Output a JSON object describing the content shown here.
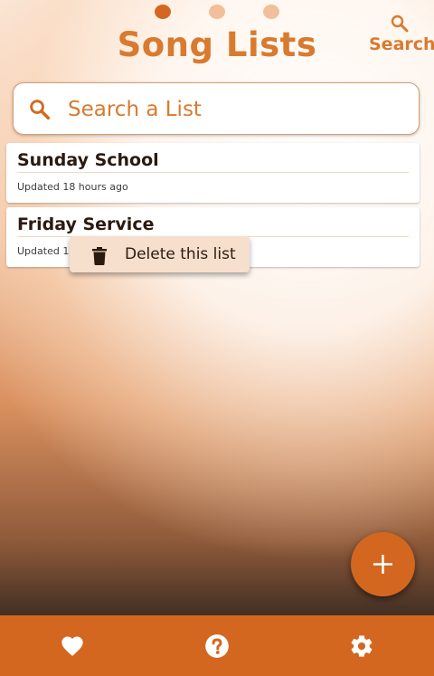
{
  "header": {
    "title": "Song Lists",
    "search_label": "Search",
    "page_indicator": {
      "count": 3,
      "active": 0
    }
  },
  "search": {
    "placeholder": "Search a List",
    "value": ""
  },
  "lists": [
    {
      "name": "Sunday School",
      "updated": "Updated 18 hours ago"
    },
    {
      "name": "Friday Service",
      "updated": "Updated 18 hours ago"
    }
  ],
  "context_menu": {
    "delete_label": "Delete this list"
  },
  "bottom_nav": {
    "items": [
      {
        "icon": "heart-icon"
      },
      {
        "icon": "help-icon"
      },
      {
        "icon": "gear-icon"
      }
    ]
  },
  "colors": {
    "accent": "#d4671f",
    "accent_text": "#d97a2e",
    "menu_bg": "#f7dfcd"
  }
}
